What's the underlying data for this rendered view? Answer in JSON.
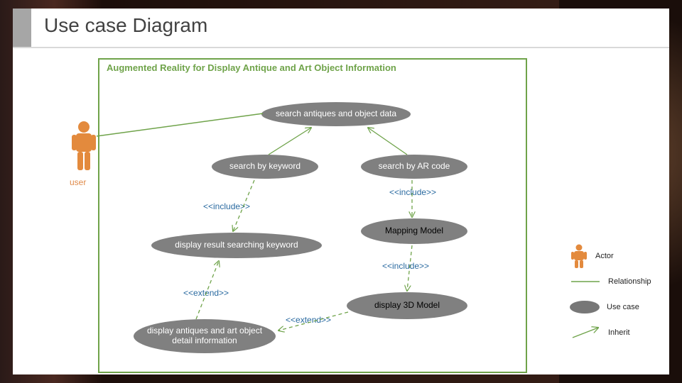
{
  "slide": {
    "title": "Use case Diagram"
  },
  "system_box": {
    "title": "Augmented Reality for Display Antique and Art Object Information"
  },
  "actor": {
    "label": "user"
  },
  "usecases": {
    "search_data": "search antiques and object data",
    "by_keyword": "search by keyword",
    "by_arcode": "search by AR code",
    "display_result": "display result searching keyword",
    "mapping_model": "Mapping Model",
    "display_detail": "display antiques and art object detail information",
    "display_3d": "display 3D Model"
  },
  "stereotypes": {
    "include1": "<<include>>",
    "include2": "<<include>>",
    "include3": "<<include>>",
    "extend1": "<<extend>>",
    "extend2": "<<extend>>"
  },
  "legend": {
    "actor": "Actor",
    "relationship": "Relationship",
    "usecase": "Use case",
    "inherit": "Inherit"
  },
  "colors": {
    "accent_green": "#6fa34a",
    "actor_orange": "#e38a3d",
    "ellipse_gray": "#808080",
    "stereotype_blue": "#2a6aa0"
  }
}
